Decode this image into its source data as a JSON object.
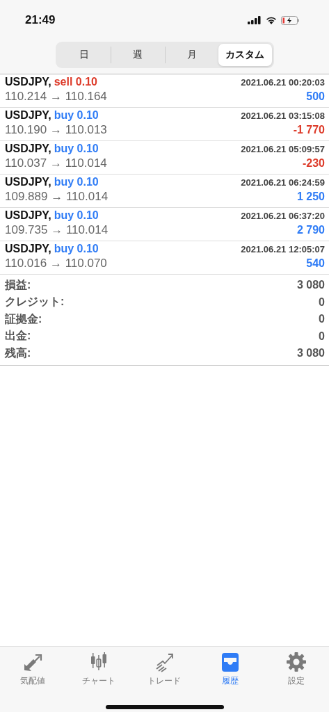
{
  "status_bar": {
    "time": "21:49"
  },
  "segments": [
    {
      "label": "日",
      "selected": false
    },
    {
      "label": "週",
      "selected": false
    },
    {
      "label": "月",
      "selected": false
    },
    {
      "label": "カスタム",
      "selected": true
    }
  ],
  "trades": [
    {
      "symbol": "USDJPY,",
      "kind": "sell",
      "order": "sell 0.10",
      "time": "2021.06.21 00:20:03",
      "prices": "110.214 → 110.164",
      "profit": "500",
      "loss": false
    },
    {
      "symbol": "USDJPY,",
      "kind": "buy",
      "order": "buy 0.10",
      "time": "2021.06.21 03:15:08",
      "prices": "110.190 → 110.013",
      "profit": "-1 770",
      "loss": true
    },
    {
      "symbol": "USDJPY,",
      "kind": "buy",
      "order": "buy 0.10",
      "time": "2021.06.21 05:09:57",
      "prices": "110.037 → 110.014",
      "profit": "-230",
      "loss": true
    },
    {
      "symbol": "USDJPY,",
      "kind": "buy",
      "order": "buy 0.10",
      "time": "2021.06.21 06:24:59",
      "prices": "109.889 → 110.014",
      "profit": "1 250",
      "loss": false
    },
    {
      "symbol": "USDJPY,",
      "kind": "buy",
      "order": "buy 0.10",
      "time": "2021.06.21 06:37:20",
      "prices": "109.735 → 110.014",
      "profit": "2 790",
      "loss": false
    },
    {
      "symbol": "USDJPY,",
      "kind": "buy",
      "order": "buy 0.10",
      "time": "2021.06.21 12:05:07",
      "prices": "110.016 → 110.070",
      "profit": "540",
      "loss": false
    }
  ],
  "summary": [
    {
      "label": "損益:",
      "value": "3 080"
    },
    {
      "label": "クレジット:",
      "value": "0"
    },
    {
      "label": "証拠金:",
      "value": "0"
    },
    {
      "label": "出金:",
      "value": "0"
    },
    {
      "label": "残高:",
      "value": "3 080"
    }
  ],
  "tab_bar": [
    {
      "kind": "quotes",
      "label": "気配値",
      "selected": false
    },
    {
      "kind": "chart",
      "label": "チャート",
      "selected": false
    },
    {
      "kind": "trade",
      "label": "トレード",
      "selected": false
    },
    {
      "kind": "history",
      "label": "履歴",
      "selected": true
    },
    {
      "kind": "settings",
      "label": "設定",
      "selected": false
    }
  ]
}
